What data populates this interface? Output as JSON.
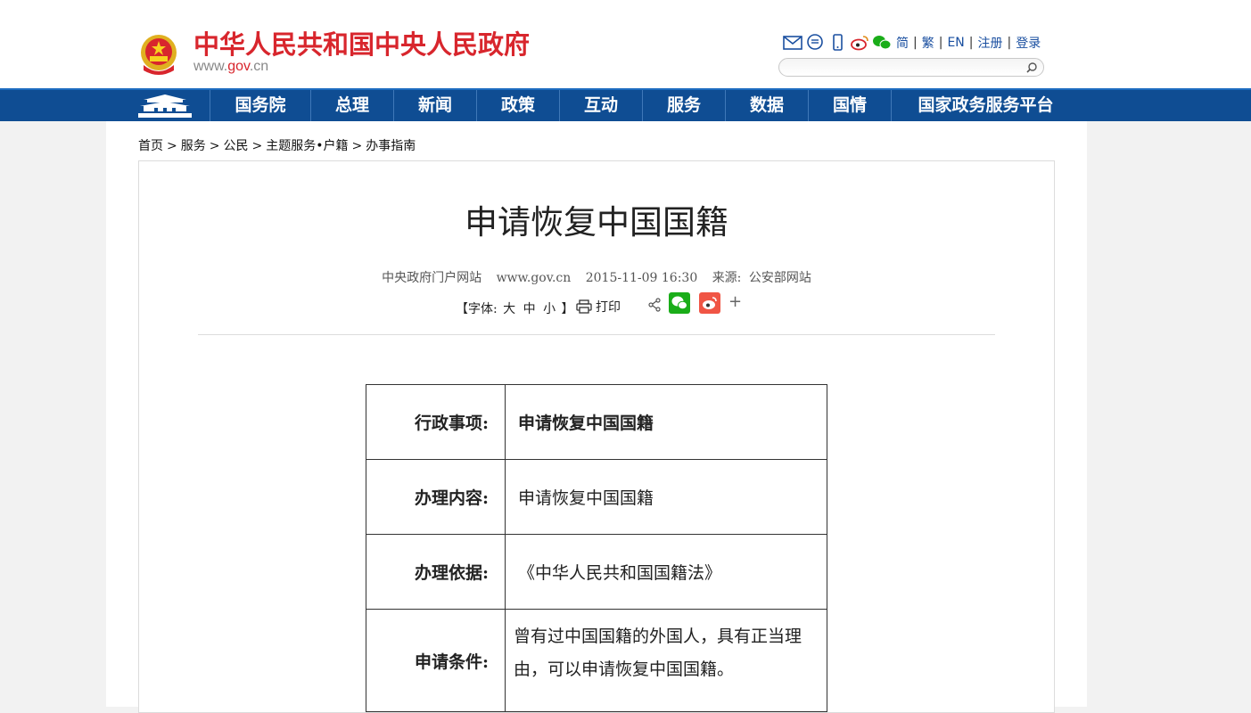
{
  "header": {
    "site_name": "中华人民共和国中央人民政府",
    "url_prefix": "www.",
    "url_mid": "gov",
    "url_suffix": ".cn",
    "lang": [
      "简",
      "繁",
      "EN"
    ],
    "register": "注册",
    "login": "登录",
    "search_placeholder": ""
  },
  "nav": {
    "items": [
      "国务院",
      "总理",
      "新闻",
      "政策",
      "互动",
      "服务",
      "数据",
      "国情",
      "国家政务服务平台"
    ]
  },
  "breadcrumb": {
    "items": [
      "首页",
      "服务",
      "公民",
      "主题服务•户籍",
      "办事指南"
    ],
    "separator": ">"
  },
  "article": {
    "title": "申请恢复中国国籍",
    "site": "中央政府门户网站",
    "url": "www.gov.cn",
    "datetime": "2015-11-09 16:30",
    "source_label": "来源:",
    "source": "公安部网站",
    "font_open": "【字体:",
    "font_sizes": [
      "大",
      "中",
      "小"
    ],
    "font_close": "】",
    "print": "打印",
    "more": "+"
  },
  "table": {
    "rows": [
      {
        "key": "行政事项:",
        "value": "申请恢复中国国籍"
      },
      {
        "key": "办理内容:",
        "value": "申请恢复中国国籍"
      },
      {
        "key": "办理依据:",
        "value": "《中华人民共和国国籍法》"
      },
      {
        "key": "申请条件:",
        "value": "曾有过中国国籍的外国人，具有正当理由，可以申请恢复中国国籍。"
      }
    ]
  },
  "colors": {
    "brand_red": "#d8262d",
    "nav_blue": "#0f4d93",
    "link_blue": "#1a4fa0"
  }
}
